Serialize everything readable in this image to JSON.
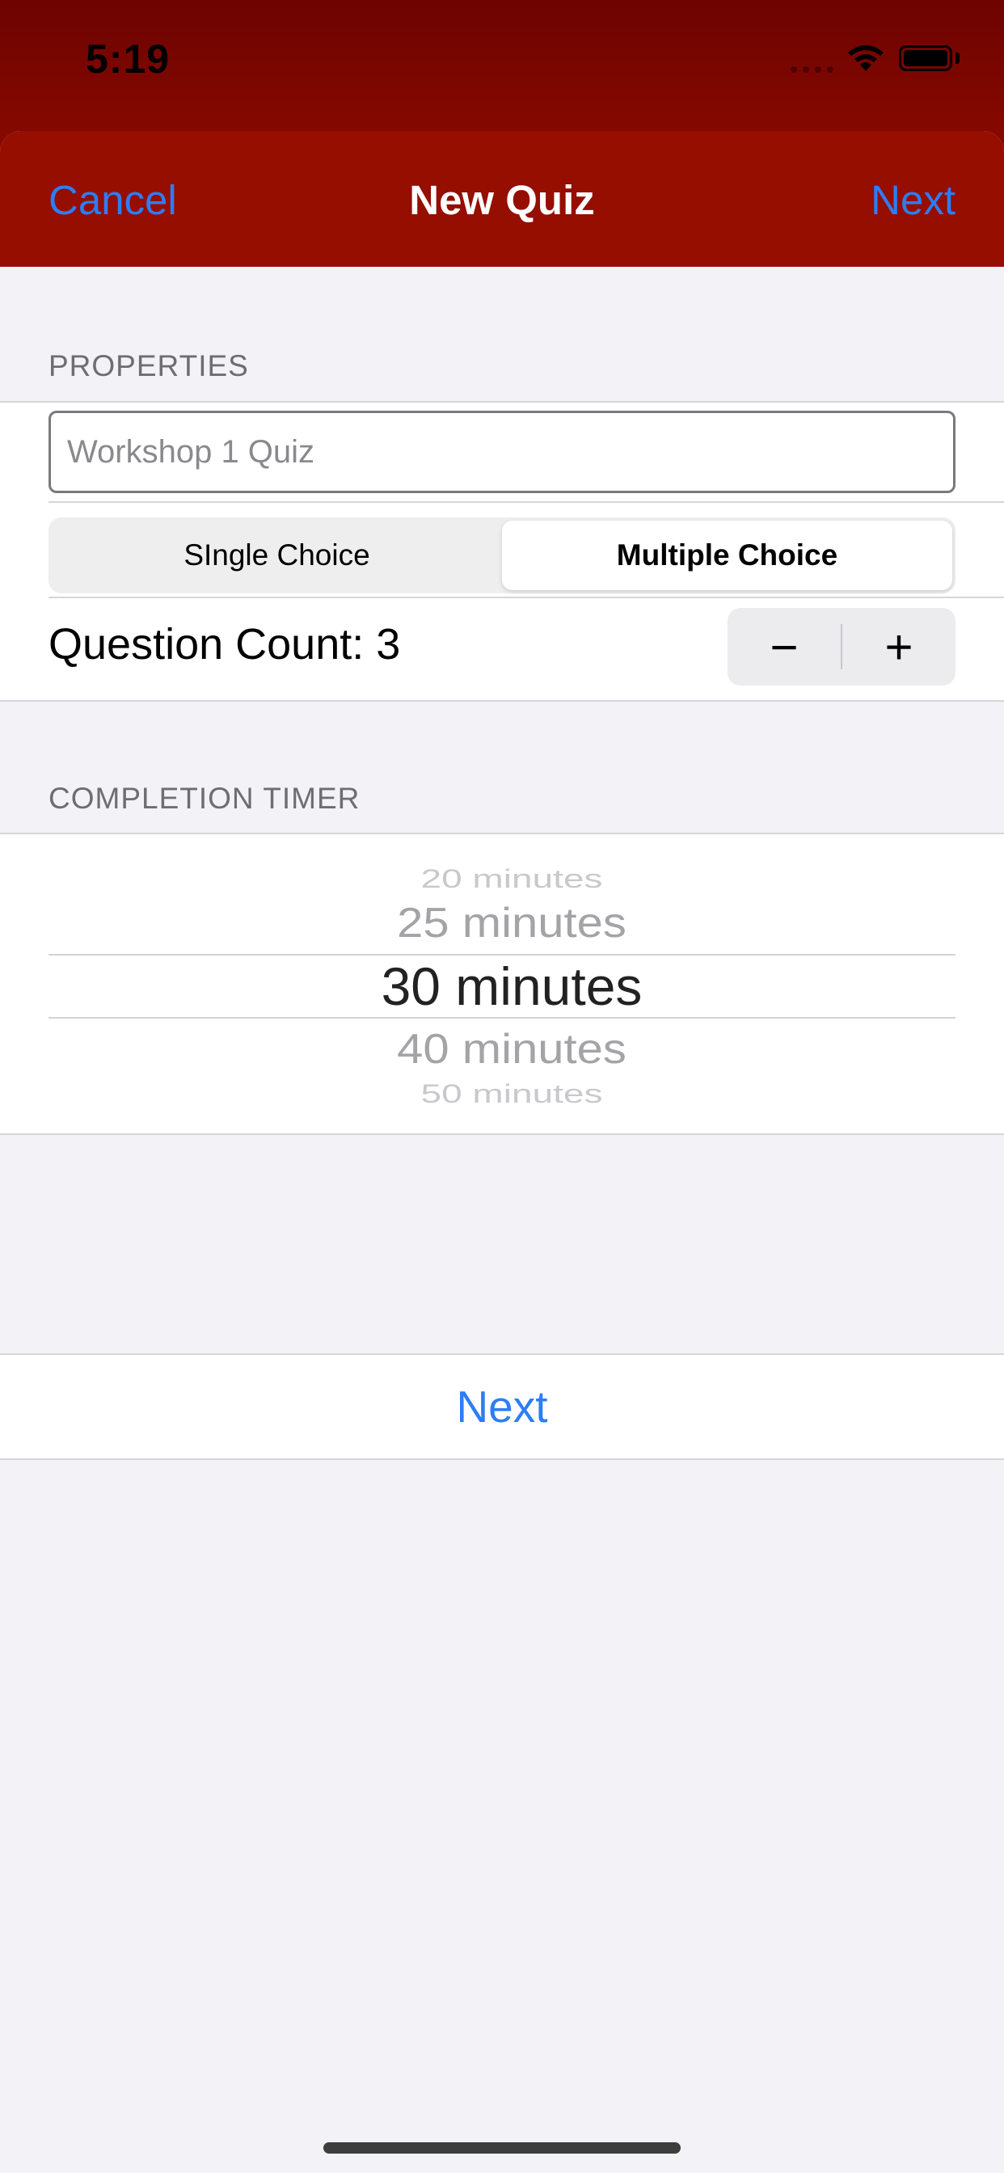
{
  "status_bar": {
    "time": "5:19",
    "icons": [
      "cellular-signal-icon",
      "wifi-icon",
      "battery-icon"
    ]
  },
  "nav": {
    "cancel_label": "Cancel",
    "title": "New Quiz",
    "next_label": "Next"
  },
  "properties": {
    "header": "PROPERTIES",
    "title_placeholder": "Workshop 1 Quiz",
    "title_value": "",
    "segments": [
      "SIngle Choice",
      "Multiple Choice"
    ],
    "selected_segment": "Multiple Choice",
    "question_count_label": "Question Count: 3",
    "question_count": 3,
    "stepper_minus": "−",
    "stepper_plus": "+"
  },
  "timer": {
    "header": "COMPLETION TIMER",
    "options": [
      "20 minutes",
      "25 minutes",
      "30 minutes",
      "40 minutes",
      "50 minutes"
    ],
    "selected": "30 minutes"
  },
  "footer": {
    "next_label": "Next"
  },
  "colors": {
    "nav_background": "#950e00",
    "status_background": "#6e0300",
    "accent_blue": "#2d7df6",
    "page_background": "#f2f2f7"
  }
}
